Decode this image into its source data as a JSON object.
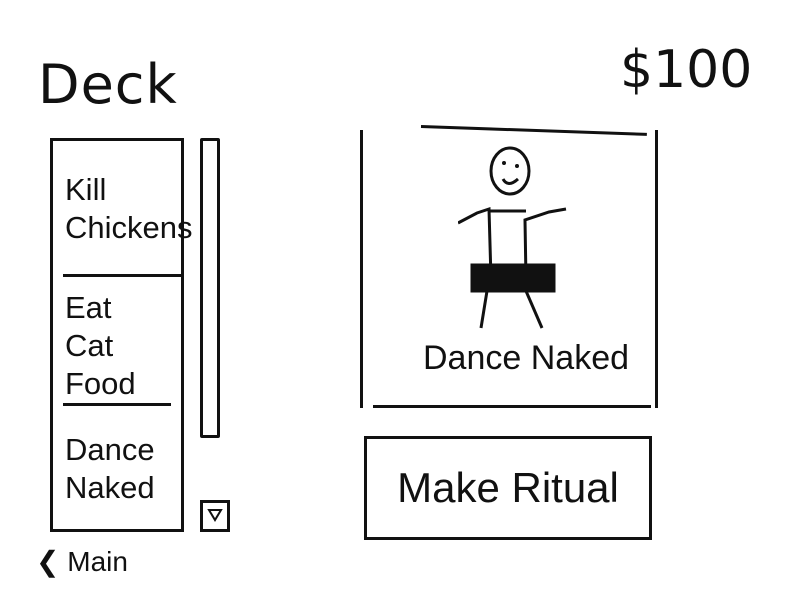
{
  "header": {
    "title": "Deck",
    "money": "$100"
  },
  "deck": {
    "items": [
      {
        "label": "Kill\nChickens"
      },
      {
        "label": "Eat\nCat Food"
      },
      {
        "label": "Dance\nNaked"
      }
    ],
    "scroll_down_icon": "triangle-down"
  },
  "selected_card": {
    "caption": "Dance Naked",
    "figure_icon": "dancing-figure"
  },
  "actions": {
    "make_ritual_label": "Make Ritual"
  },
  "navigation": {
    "back_label": "Main",
    "back_icon": "chevron-left"
  }
}
